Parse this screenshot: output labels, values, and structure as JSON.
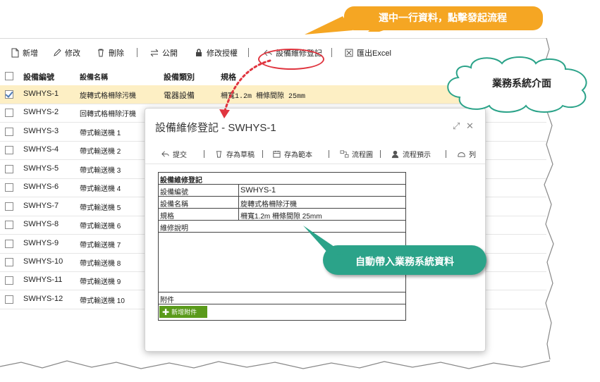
{
  "toolbar": {
    "new": "新增",
    "edit": "修改",
    "delete": "刪除",
    "public": "公開",
    "edit_auth": "修改授權",
    "maintenance": "設備維修登記",
    "export": "匯出Excel"
  },
  "grid": {
    "headers": {
      "id": "設備編號",
      "name": "設備名稱",
      "type": "設備類別",
      "spec": "規格"
    },
    "rows": [
      {
        "id": "SWHYS-1",
        "name": "旋轉式格柵除污機",
        "type": "電器設備",
        "spec": "柵寬1.2m 柵條間隙 25mm",
        "checked": true
      },
      {
        "id": "SWHYS-2",
        "name": "回轉式格柵除汙機"
      },
      {
        "id": "SWHYS-3",
        "name": "帶式輸送機 1"
      },
      {
        "id": "SWHYS-4",
        "name": "帶式輸送機 2"
      },
      {
        "id": "SWHYS-5",
        "name": "帶式輸送機 3"
      },
      {
        "id": "SWHYS-6",
        "name": "帶式輸送機 4"
      },
      {
        "id": "SWHYS-7",
        "name": "帶式輸送機 5"
      },
      {
        "id": "SWHYS-8",
        "name": "帶式輸送機 6"
      },
      {
        "id": "SWHYS-9",
        "name": "帶式輸送機 7"
      },
      {
        "id": "SWHYS-10",
        "name": "帶式輸送機 8"
      },
      {
        "id": "SWHYS-11",
        "name": "帶式輸送機 9"
      },
      {
        "id": "SWHYS-12",
        "name": "帶式輸送機 10"
      }
    ]
  },
  "dialog": {
    "title": "設備維修登記 - SWHYS-1",
    "toolbar": {
      "submit": "提交",
      "save_draft": "存為草稿",
      "save_template": "存為範本",
      "flowchart": "流程圖",
      "flow_preview": "流程預示",
      "more": "列"
    },
    "form": {
      "title": "設備維修登記",
      "id_label": "設備編號",
      "id_value": "SWHYS-1",
      "name_label": "設備名稱",
      "name_value": "旋轉式格柵除汙機",
      "spec_label": "規格",
      "spec_value": "柵寬1.2m 柵條間隙 25mm",
      "desc_label": "維修說明",
      "attach_label": "附件",
      "add_attach": "新增附件"
    }
  },
  "callouts": {
    "top": "選中一行資料，點擊發起流程",
    "cloud": "業務系統介面",
    "auto": "自動帶入業務系統資料"
  },
  "colors": {
    "orange": "#f5a623",
    "green": "#2ba389",
    "selected_row": "#fdefc4",
    "highlight_ring": "#e0353f",
    "add_button": "#5a9a1b"
  }
}
